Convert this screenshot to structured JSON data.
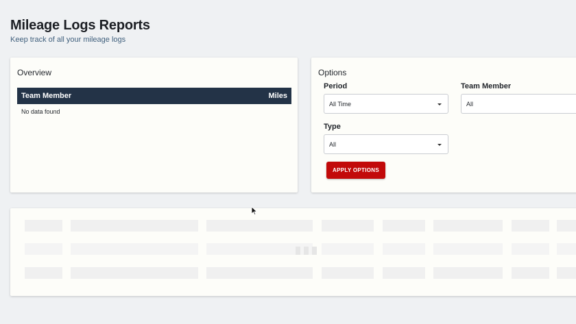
{
  "header": {
    "title": "Mileage Logs Reports",
    "subtitle": "Keep track of all your mileage logs"
  },
  "overview": {
    "title": "Overview",
    "columns": [
      "Team Member",
      "Miles"
    ],
    "empty_text": "No data found"
  },
  "options": {
    "title": "Options",
    "period": {
      "label": "Period",
      "value": "All Time"
    },
    "team_member": {
      "label": "Team Member",
      "value": "All"
    },
    "type": {
      "label": "Type",
      "value": "All"
    },
    "apply_label": "APPLY OPTIONS"
  },
  "colors": {
    "table_header": "#233347",
    "apply_button": "#c20a0a",
    "page_background": "#eff1f3",
    "card_background": "#fdfdf9"
  },
  "icons": [
    "chevron-down-icon",
    "mouse-cursor-icon",
    "loading-indicator"
  ]
}
